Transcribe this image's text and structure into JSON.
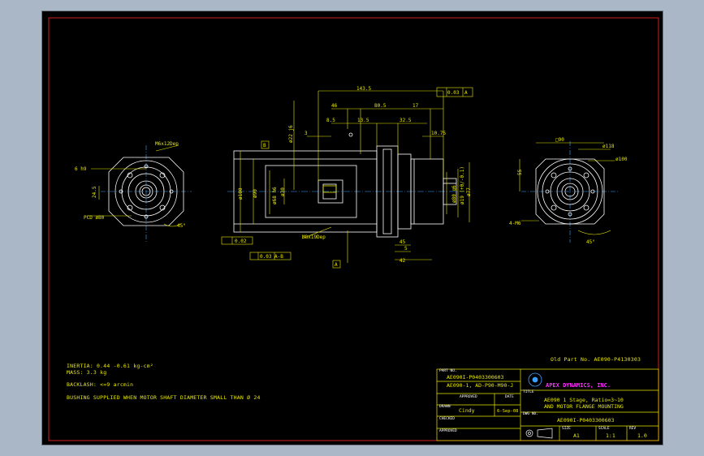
{
  "colors": {
    "background": "#000000",
    "border": "#d02020",
    "geometry": "#ffffff",
    "dimensions": "#e8e800",
    "accent": "#ff2cff",
    "center": "#3aa0ff"
  },
  "notes": {
    "inertia": "INERTIA:  0.44 -0.61 kg-cm²",
    "mass": "MASS:  3.3 kg",
    "backlash": "BACKLASH: <=9 arcmin",
    "bushing": "BUSHING SUPPLIED WHEN MOTOR SHAFT DIAMETER SMALL THAN Ø 24"
  },
  "old_part_no": "Old Part No. AE090-P4130303",
  "title_block": {
    "part_no_label": "PART NO.",
    "part_no_line1": "AE090I-P0403300603",
    "part_no_line2": "AE090-1, AD-P90-M90-J",
    "approved_label": "APPROVED",
    "date_label": "DATE",
    "drawn_label": "DRAWN",
    "drawn_by": "Cindy",
    "date": "6-Sep-08",
    "checked_label": "CHECKED",
    "approved2_label": "APPROVED",
    "company": "APEX DYNAMICS, INC.",
    "title_label": "TITLE",
    "title_line1": "AE090 1 Stage, Ratio=3~10",
    "title_line2": "AND MOTOR FLANGE MOUNTING",
    "dwg_label": "DWG NO.",
    "dwg_no": "AE090I-P0403300603",
    "size_label": "SIZE",
    "size": "A1",
    "scale_label": "SCALE",
    "scale": "1:1",
    "rev_label": "REV",
    "rev": "1.0"
  },
  "dimensions": {
    "overall": "143.5",
    "d46": "46",
    "d805": "80.5",
    "d17": "17",
    "d85": "8.5",
    "d135": "13.5",
    "d325": "32.5",
    "d3": "3",
    "d1075": "10.75",
    "runout": "0.03",
    "datumA": "A",
    "datumB": "B",
    "d_shaft": "ø22 j6",
    "d_bore": "ø30",
    "d_pilot": "ø80 g6",
    "d_body": "ø100",
    "d_90": "ø90",
    "d68": "ø68 h6",
    "d77": "ø77",
    "d_key": "ø19 (+0/-0.1)",
    "d42": "42",
    "d5": "5",
    "d45": "45",
    "d02": "0.02",
    "d003": "0.03 A-B",
    "m8": "M8x19Dep",
    "m6": "M6x12Dep",
    "pcd": "PCD ø80",
    "key6": "6 h9",
    "d245": "24.5",
    "d45deg": "45°",
    "sq90": "□90",
    "d118": "ø118",
    "d100": "ø100",
    "d55": "55",
    "holes": "4-M6",
    "d45deg2": "45°"
  }
}
